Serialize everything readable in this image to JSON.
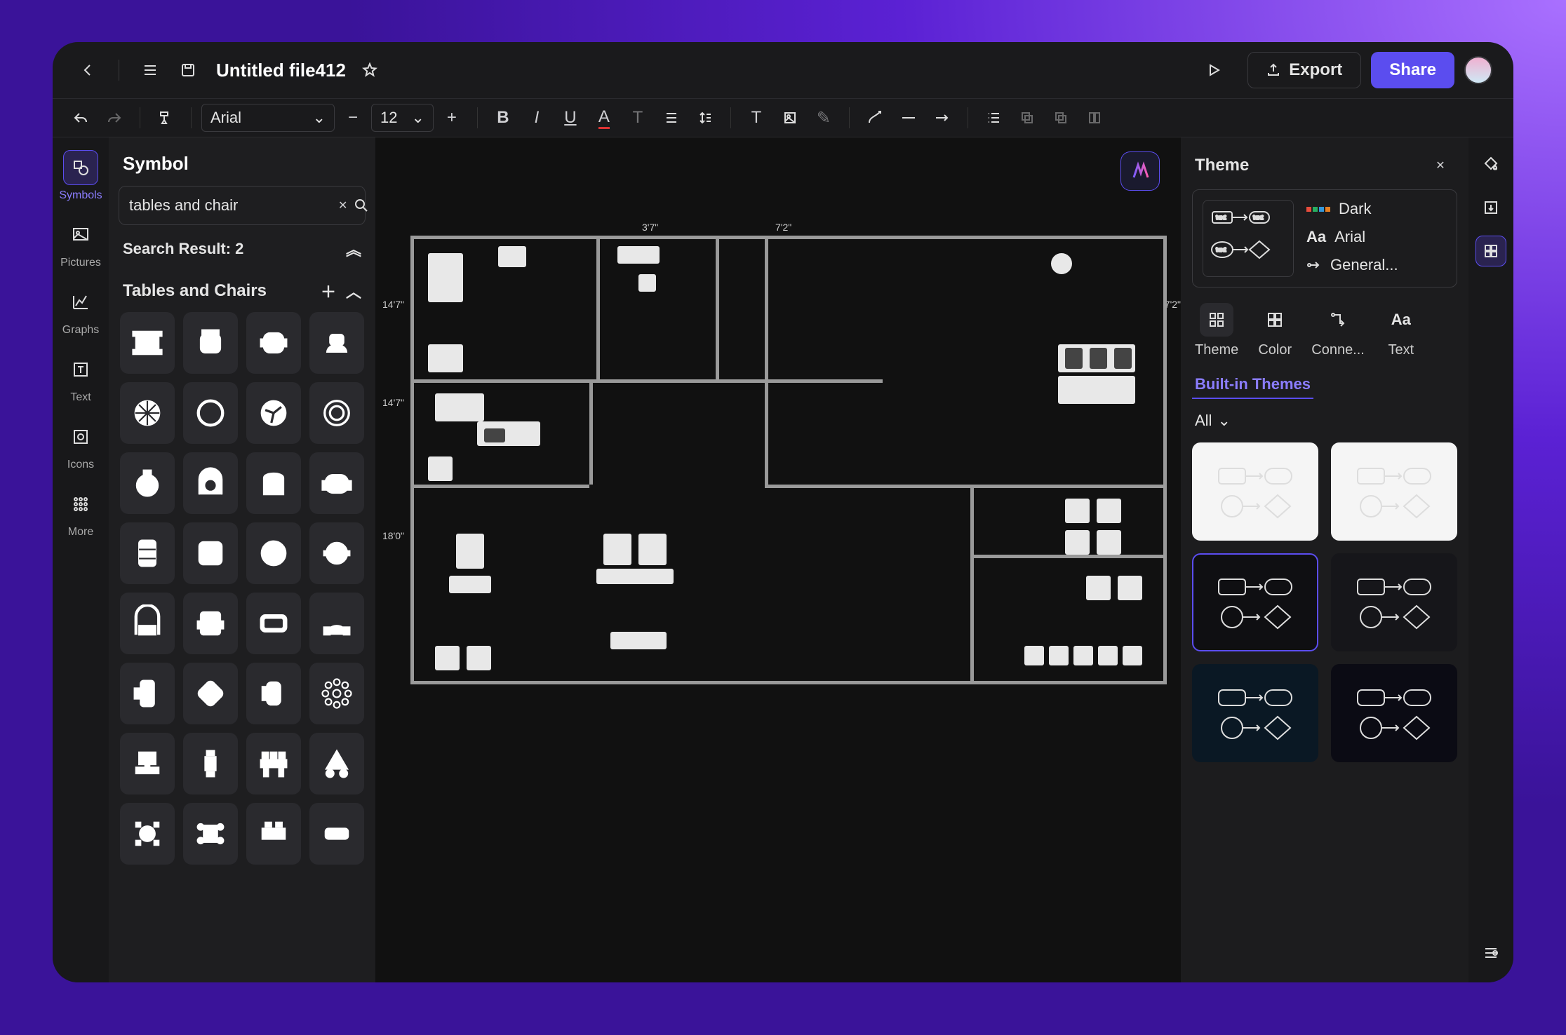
{
  "doc": {
    "title": "Untitled file412"
  },
  "header": {
    "export": "Export",
    "share": "Share"
  },
  "toolbar": {
    "font": "Arial",
    "size": "12"
  },
  "leftRail": {
    "items": [
      {
        "label": "Symbols"
      },
      {
        "label": "Pictures"
      },
      {
        "label": "Graphs"
      },
      {
        "label": "Text"
      },
      {
        "label": "Icons"
      },
      {
        "label": "More"
      }
    ]
  },
  "symbolPanel": {
    "title": "Symbol",
    "search": "tables and chair",
    "searchResult": "Search Result: 2",
    "groupTitle": "Tables and Chairs"
  },
  "themePanel": {
    "title": "Theme",
    "themeName": "Dark",
    "fontName": "Arial",
    "connector": "General...",
    "tabs": [
      {
        "label": "Theme"
      },
      {
        "label": "Color"
      },
      {
        "label": "Conne..."
      },
      {
        "label": "Text"
      }
    ],
    "builtIn": "Built-in Themes",
    "filter": "All"
  },
  "dims": {
    "a": "14'7\"",
    "b": "14'7\"",
    "c": "18'0\"",
    "d": "3'7\"",
    "e": "7'2\"",
    "f": "7'2\""
  }
}
